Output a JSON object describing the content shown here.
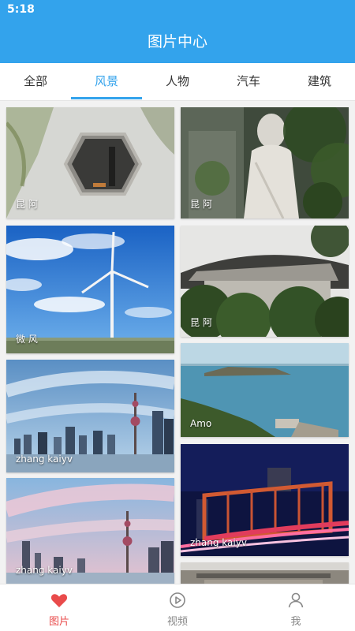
{
  "status_bar": {
    "time": "5:18"
  },
  "header": {
    "title": "图片中心"
  },
  "tabs": [
    {
      "label": "全部",
      "active": false
    },
    {
      "label": "风景",
      "active": true
    },
    {
      "label": "人物",
      "active": false
    },
    {
      "label": "汽车",
      "active": false
    },
    {
      "label": "建筑",
      "active": false
    }
  ],
  "photos": [
    {
      "author": "昆 阿",
      "scene": "hexagon-mirror-plants"
    },
    {
      "author": "昆 阿",
      "scene": "statue-foliage"
    },
    {
      "author": "微 风",
      "scene": "wind-turbine-sky"
    },
    {
      "author": "昆 阿",
      "scene": "chinese-roof-trees"
    },
    {
      "author": "zhang kaiyv",
      "scene": "shanghai-skyline-blue"
    },
    {
      "author": "Amo",
      "scene": "coastline-sea"
    },
    {
      "author": "zhang kaiyv",
      "scene": "shanghai-skyline-pink"
    },
    {
      "author": "zhang kaiyv",
      "scene": "bridge-night-light-trails"
    },
    {
      "author": "",
      "scene": "building-partial"
    }
  ],
  "bottom_nav": [
    {
      "label": "图片",
      "icon": "heart-icon",
      "active": true
    },
    {
      "label": "视频",
      "icon": "play-circle-icon",
      "active": false
    },
    {
      "label": "我",
      "icon": "person-icon",
      "active": false
    }
  ],
  "colors": {
    "primary": "#33a3ec",
    "active_nav": "#e94b4b"
  }
}
